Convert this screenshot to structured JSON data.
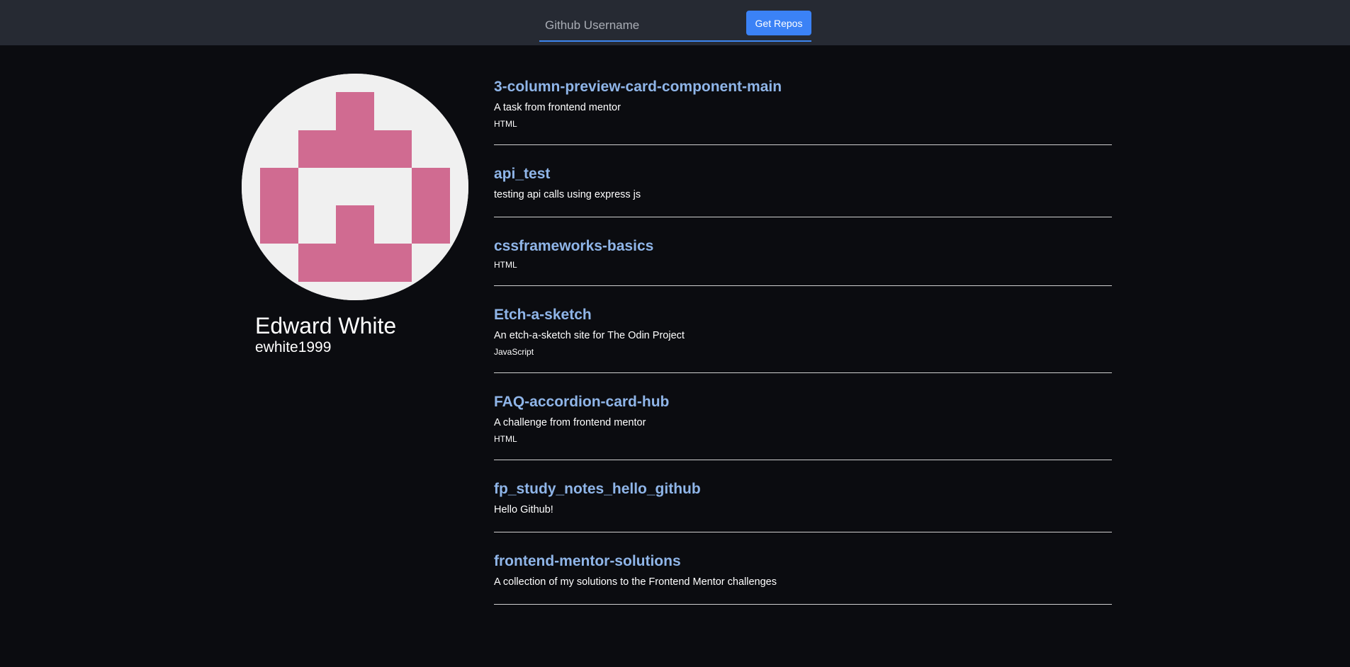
{
  "header": {
    "search": {
      "placeholder": "Github Username",
      "value": ""
    },
    "get_repos_label": "Get Repos",
    "accent_color": "#3b82f6"
  },
  "profile": {
    "name": "Edward White",
    "username": "ewhite1999",
    "avatar_color": "#d06b91"
  },
  "repos": [
    {
      "name": "3-column-preview-card-component-main",
      "description": "A task from frontend mentor",
      "language": "HTML"
    },
    {
      "name": "api_test",
      "description": "testing api calls using express js",
      "language": ""
    },
    {
      "name": "cssframeworks-basics",
      "description": "",
      "language": "HTML"
    },
    {
      "name": "Etch-a-sketch",
      "description": "An etch-a-sketch site for The Odin Project",
      "language": "JavaScript"
    },
    {
      "name": "FAQ-accordion-card-hub",
      "description": "A challenge from frontend mentor",
      "language": "HTML"
    },
    {
      "name": "fp_study_notes_hello_github",
      "description": "Hello Github!",
      "language": ""
    },
    {
      "name": "frontend-mentor-solutions",
      "description": "A collection of my solutions to the Frontend Mentor challenges",
      "language": ""
    }
  ]
}
